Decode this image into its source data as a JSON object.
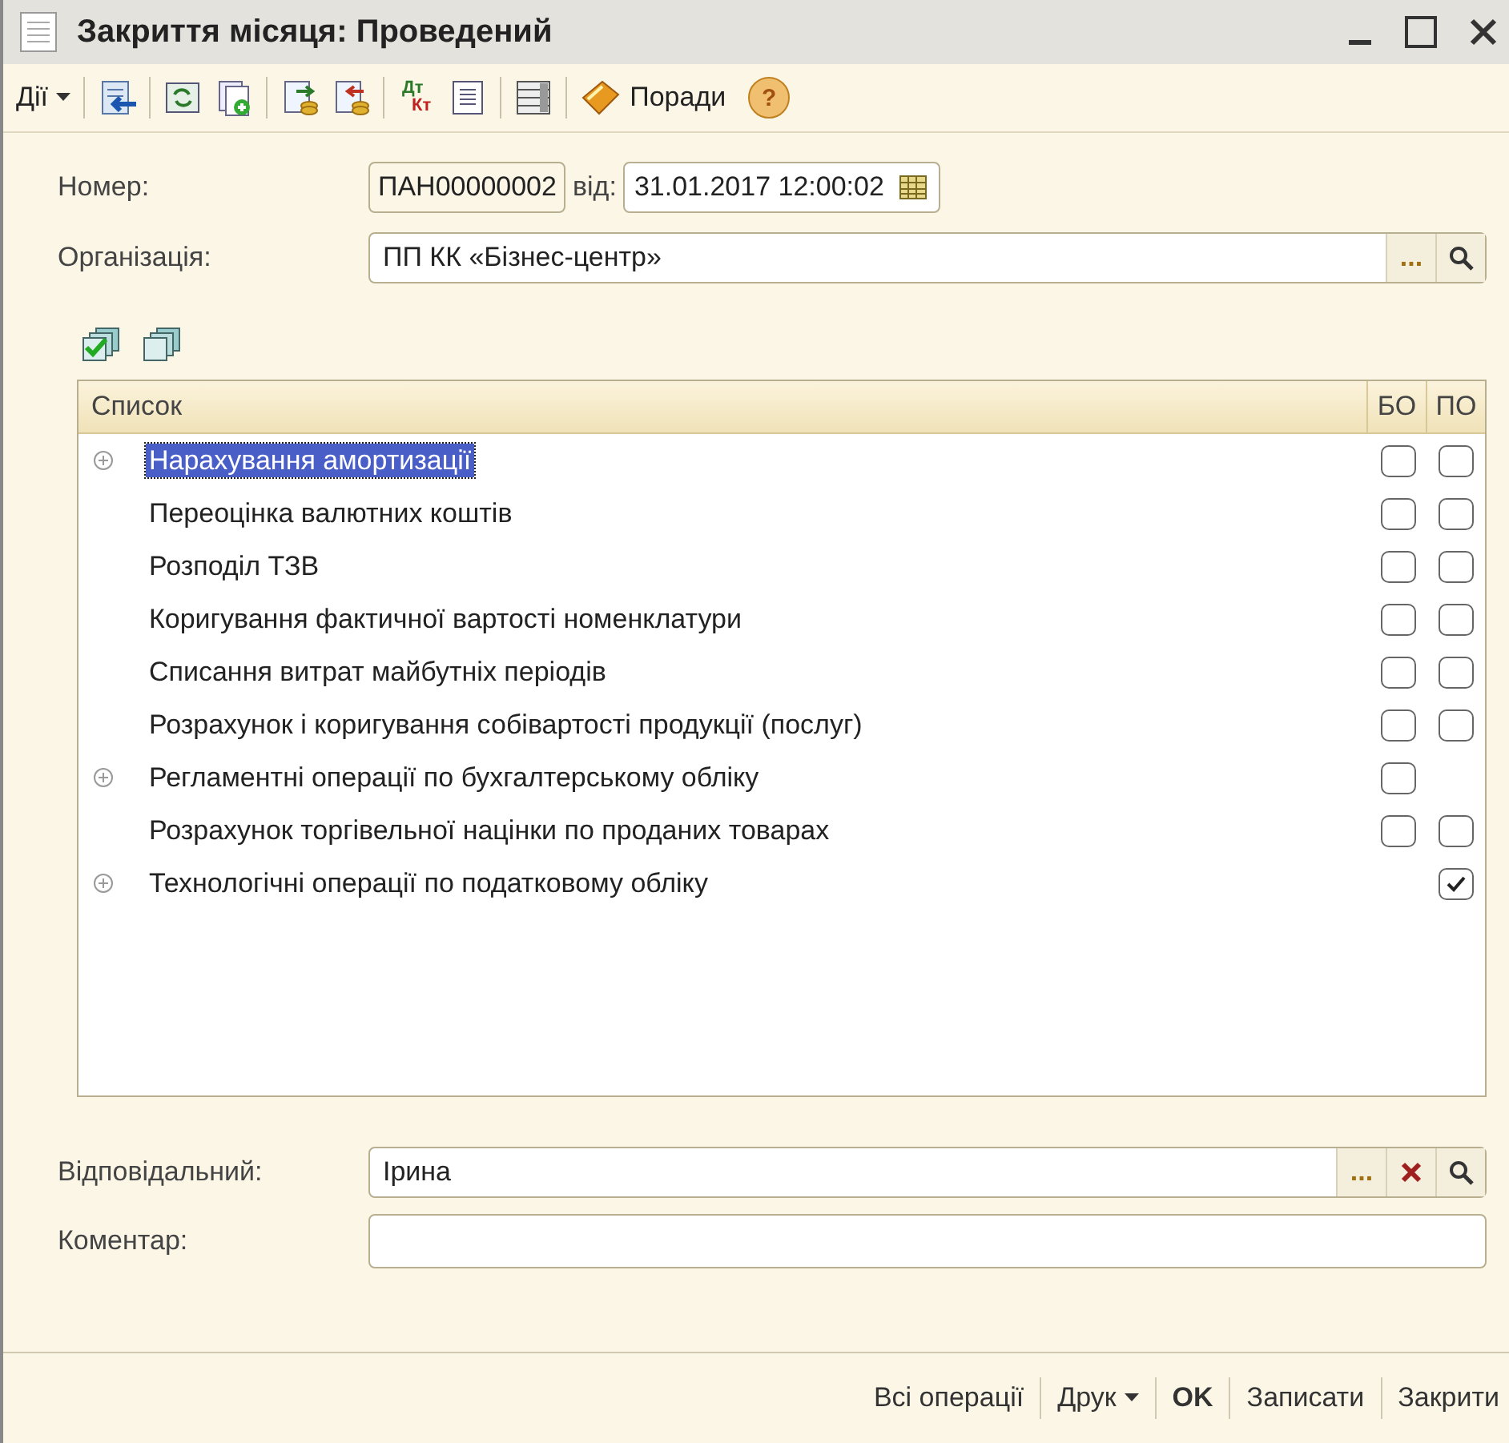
{
  "window": {
    "title": "Закриття місяця: Проведений"
  },
  "toolbar": [
    {
      "kind": "menu",
      "label": "Дії"
    },
    {
      "kind": "separator"
    },
    {
      "kind": "icon"
    },
    {
      "kind": "separator"
    },
    {
      "kind": "icon"
    },
    {
      "kind": "icon"
    },
    {
      "kind": "separator"
    },
    {
      "kind": "icon"
    },
    {
      "kind": "icon"
    },
    {
      "kind": "separator"
    },
    {
      "kind": "dtkt",
      "top": "Дт",
      "bottom": "Кт"
    },
    {
      "kind": "icon"
    },
    {
      "kind": "separator"
    },
    {
      "kind": "icon"
    },
    {
      "kind": "separator"
    },
    {
      "kind": "tips",
      "label": "Поради"
    },
    {
      "kind": "help",
      "label": "?"
    }
  ],
  "number": {
    "label": "Номер:",
    "value": "ПАН00000002",
    "date_label": "від:",
    "date": "31.01.2017 12:00:02"
  },
  "organization": {
    "label": "Організація:",
    "value": "ПП КК «Бізнес-центр»",
    "select_label": "..."
  },
  "list": {
    "columns": [
      "Список",
      "БО",
      "ПО"
    ],
    "rows": [
      {
        "name": "Нарахування амортизації",
        "expandable": true,
        "selected": true,
        "bo": false,
        "po": false
      },
      {
        "name": "Переоцінка валютних коштів",
        "expandable": false,
        "selected": false,
        "bo": false,
        "po": false
      },
      {
        "name": "Розподіл ТЗВ",
        "expandable": false,
        "selected": false,
        "bo": false,
        "po": false
      },
      {
        "name": "Коригування фактичної вартості номенклатури",
        "expandable": false,
        "selected": false,
        "bo": false,
        "po": false
      },
      {
        "name": "Списання витрат майбутніх періодів",
        "expandable": false,
        "selected": false,
        "bo": false,
        "po": false
      },
      {
        "name": "Розрахунок і коригування собівартості продукції (послуг)",
        "expandable": false,
        "selected": false,
        "bo": false,
        "po": false
      },
      {
        "name": "Регламентні операції по бухгалтерському обліку",
        "expandable": true,
        "selected": false,
        "bo": false
      },
      {
        "name": "Розрахунок торгівельної націнки по проданих товарах",
        "expandable": false,
        "selected": false,
        "bo": false,
        "po": false
      },
      {
        "name": "Технологічні операції по податковому обліку",
        "expandable": true,
        "selected": false,
        "po": true
      }
    ]
  },
  "responsible": {
    "label": "Відповідальний:",
    "value": "Ірина",
    "select_label": "..."
  },
  "comment": {
    "label": "Коментар:"
  },
  "buttons": [
    {
      "label": "Всі операції",
      "kind": "plain"
    },
    {
      "label": "Друк",
      "kind": "menu"
    },
    {
      "label": "OK",
      "kind": "default"
    },
    {
      "label": "Записати",
      "kind": "plain"
    },
    {
      "label": "Закрити",
      "kind": "plain"
    }
  ]
}
